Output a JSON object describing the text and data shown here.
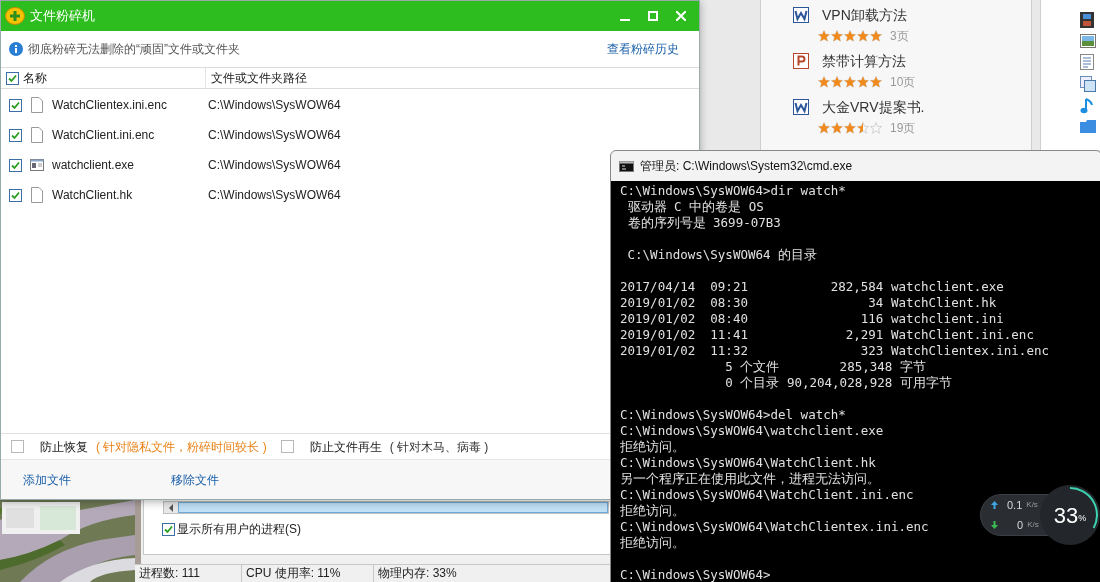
{
  "shredder": {
    "title": "文件粉碎机",
    "info": "彻底粉碎无法删除的“顽固”文件或文件夹",
    "history_link": "查看粉碎历史",
    "header": {
      "checked": true,
      "columns": [
        "名称",
        "文件或文件夹路径"
      ]
    },
    "files": [
      {
        "checked": true,
        "kind": "file",
        "name": "WatchClientex.ini.enc",
        "path": "C:\\Windows\\SysWOW64"
      },
      {
        "checked": true,
        "kind": "file",
        "name": "WatchClient.ini.enc",
        "path": "C:\\Windows\\SysWOW64"
      },
      {
        "checked": true,
        "kind": "exe",
        "name": "watchclient.exe",
        "path": "C:\\Windows\\SysWOW64"
      },
      {
        "checked": true,
        "kind": "file",
        "name": "WatchClient.hk",
        "path": "C:\\Windows\\SysWOW64"
      }
    ],
    "options": [
      {
        "checked": false,
        "label": "防止恢复",
        "note": "( 针对隐私文件，粉碎时间较长 )",
        "highlighted": true
      },
      {
        "checked": false,
        "label": "防止文件再生",
        "note": "( 针对木马、病毒 )",
        "highlighted": false
      }
    ],
    "actions": [
      "添加文件",
      "移除文件"
    ]
  },
  "documents": [
    {
      "kind": "word",
      "title": "VPN卸载方法",
      "stars": 5,
      "pages": "3页"
    },
    {
      "kind": "ppt",
      "title": "禁带计算方法",
      "stars": 5,
      "pages": "10页"
    },
    {
      "kind": "word",
      "title": "大金VRV提案书.",
      "stars": 3.5,
      "pages": "19页"
    }
  ],
  "task_manager": {
    "show_all_users": {
      "checked": true,
      "label": "显示所有用户的进程(S)"
    },
    "status_bar": [
      "进程数: 111",
      "CPU 使用率: 11%",
      "物理内存: 33%"
    ]
  },
  "cmd": {
    "title": "管理员: C:\\Windows\\System32\\cmd.exe",
    "blocks": [
      [
        "C:\\Windows\\SysWOW64>dir watch*",
        " 驱动器 C 中的卷是 OS",
        " 卷的序列号是 3699-07B3"
      ],
      [
        " C:\\Windows\\SysWOW64 的目录"
      ],
      [
        "2017/04/14  09:21           282,584 watchclient.exe",
        "2019/01/02  08:30                34 WatchClient.hk",
        "2019/01/02  08:40               116 watchclient.ini",
        "2019/01/02  11:41             2,291 WatchClient.ini.enc",
        "2019/01/02  11:32               323 WatchClientex.ini.enc",
        "              5 个文件        285,348 字节",
        "              0 个目录 90,204,028,928 可用字节"
      ],
      [
        "C:\\Windows\\SysWOW64>del watch*",
        "C:\\Windows\\SysWOW64\\watchclient.exe",
        "拒绝访问。",
        "C:\\Windows\\SysWOW64\\WatchClient.hk",
        "另一个程序正在使用此文件，进程无法访问。",
        "C:\\Windows\\SysWOW64\\WatchClient.ini.enc",
        "拒绝访问。",
        "C:\\Windows\\SysWOW64\\WatchClientex.ini.enc",
        "拒绝访问。"
      ],
      [
        "C:\\Windows\\SysWOW64>"
      ]
    ]
  },
  "monitor": {
    "upload": "0.1",
    "upload_unit": "K/s",
    "download": "0",
    "download_unit": "K/s",
    "percent": "33",
    "percent_sign": "%"
  }
}
